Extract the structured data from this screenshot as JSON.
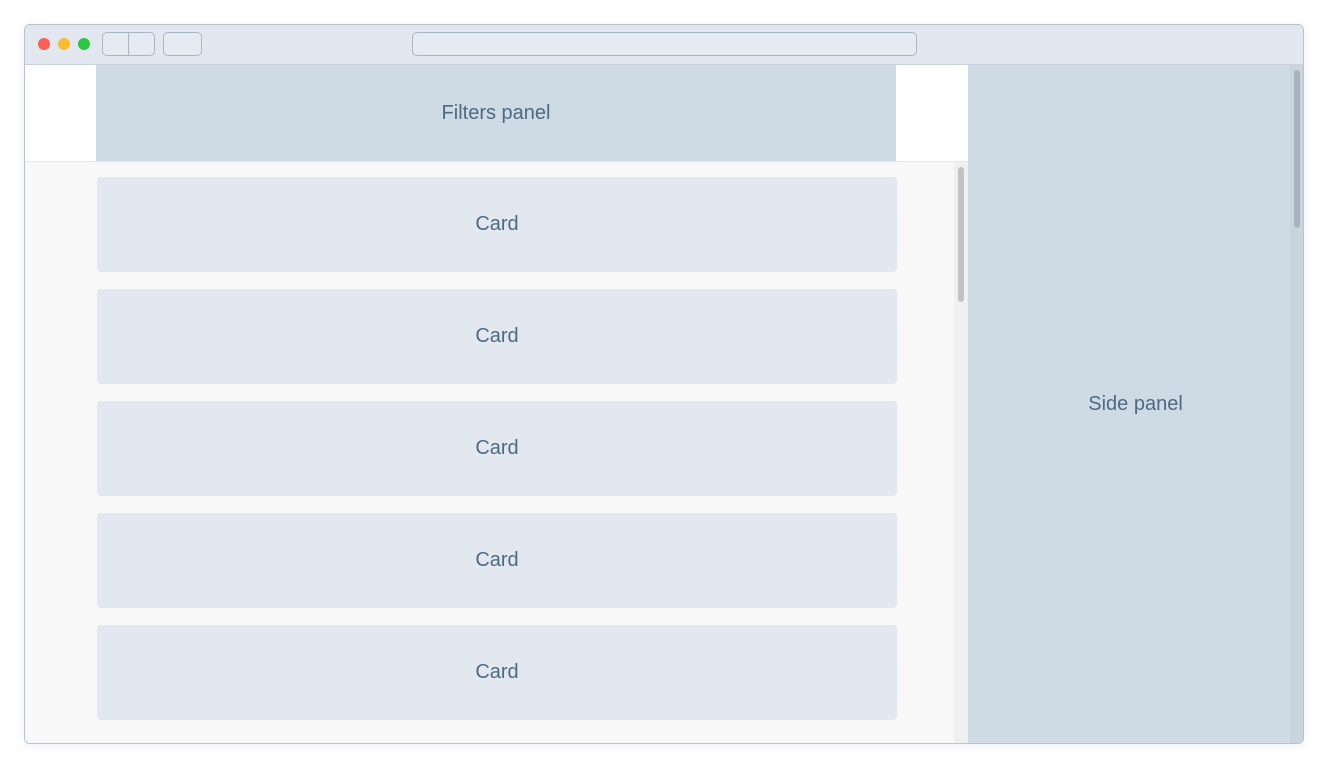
{
  "filters_panel": {
    "label": "Filters panel"
  },
  "cards": [
    {
      "label": "Card"
    },
    {
      "label": "Card"
    },
    {
      "label": "Card"
    },
    {
      "label": "Card"
    },
    {
      "label": "Card"
    }
  ],
  "side_panel": {
    "label": "Side panel"
  },
  "colors": {
    "titlebar": "#e3e8f0",
    "panel": "#cfdbe4",
    "card": "#e3e8f0",
    "text": "#4d6a82",
    "close": "#fe5f57",
    "minimize": "#febc2e",
    "maximize": "#28c840"
  }
}
